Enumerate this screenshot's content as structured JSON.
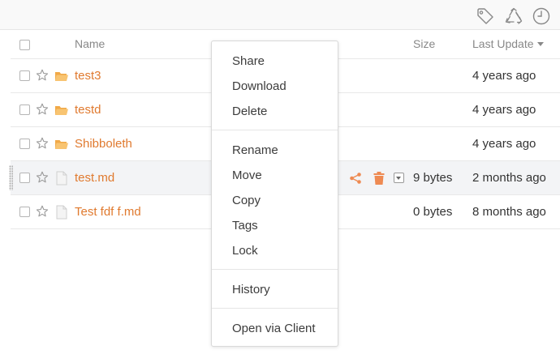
{
  "header": {
    "columns": {
      "name": "Name",
      "size": "Size",
      "last_update": "Last Update"
    },
    "icons": [
      "tag-icon",
      "recycle-icon",
      "history-clock-icon"
    ]
  },
  "rows": [
    {
      "name": "test3",
      "type": "folder",
      "size": "",
      "updated": "4 years ago"
    },
    {
      "name": "testd",
      "type": "folder",
      "size": "",
      "updated": "4 years ago"
    },
    {
      "name": "Shibboleth",
      "type": "folder",
      "size": "",
      "updated": "4 years ago"
    },
    {
      "name": "test.md",
      "type": "file",
      "size": "9 bytes",
      "updated": "2 months ago",
      "hovered": true
    },
    {
      "name": "Test fdf f.md",
      "type": "file",
      "size": "0 bytes",
      "updated": "8 months ago"
    }
  ],
  "context_menu": {
    "items": [
      "Share",
      "Download",
      "Delete",
      "Rename",
      "Move",
      "Copy",
      "Tags",
      "Lock",
      "History",
      "Open via Client"
    ]
  },
  "colors": {
    "link": "#e07a2f",
    "folder": "#f5b85b",
    "action": "#ee8a52",
    "icon_gray": "#999999"
  }
}
